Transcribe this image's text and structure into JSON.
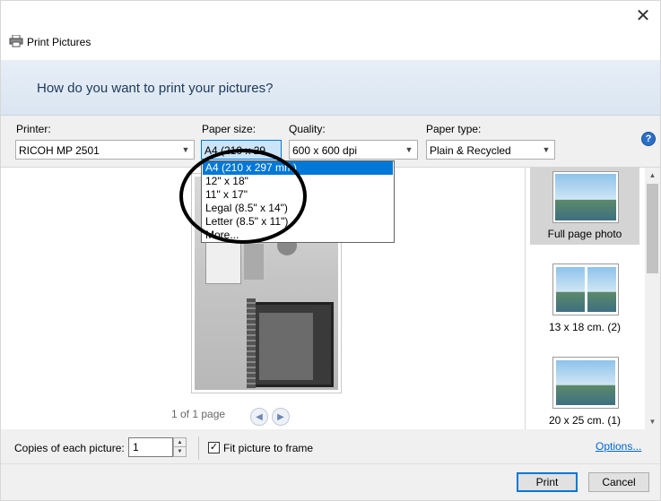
{
  "window": {
    "title": "Print Pictures",
    "close": "✕"
  },
  "banner": {
    "heading": "How do you want to print your pictures?"
  },
  "options": {
    "printer_label": "Printer:",
    "printer_value": "RICOH MP 2501",
    "paper_size_label": "Paper size:",
    "paper_size_value": "A4 (210 x 29",
    "quality_label": "Quality:",
    "quality_value": "600 x 600 dpi",
    "paper_type_label": "Paper type:",
    "paper_type_value": "Plain & Recycled",
    "help": "?"
  },
  "paper_size_dropdown": {
    "items": [
      "A4 (210 x 297 mm)",
      "12\" x 18\"",
      "11\" x 17\"",
      "Legal (8.5\" x 14\")",
      "Letter (8.5\" x 11\")",
      "More..."
    ],
    "highlighted_index": 0
  },
  "preview": {
    "page_indicator": "1 of 1 page",
    "prev": "◀",
    "next": "▶"
  },
  "layouts": [
    {
      "label": "Full page photo",
      "selected": true
    },
    {
      "label": "13 x 18 cm. (2)",
      "selected": false
    },
    {
      "label": "20 x 25 cm. (1)",
      "selected": false
    }
  ],
  "bottom": {
    "copies_label": "Copies of each picture:",
    "copies_value": "1",
    "fit_label": "Fit picture to frame",
    "fit_checked": true,
    "options_link": "Options..."
  },
  "buttons": {
    "print": "Print",
    "cancel": "Cancel"
  },
  "icons": {
    "dropdown_arrow": "chevron-down-icon",
    "printer": "printer-icon"
  }
}
